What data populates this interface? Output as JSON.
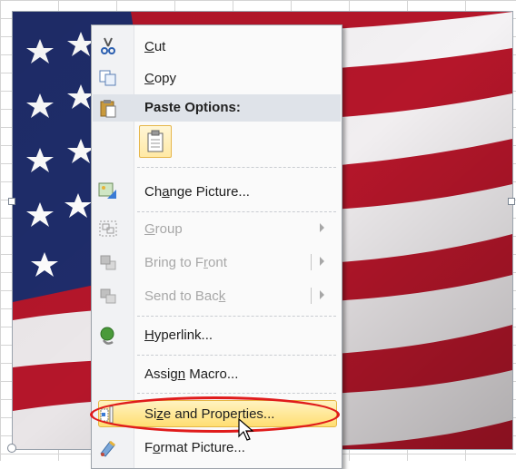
{
  "menu": {
    "items": [
      {
        "label_pre": "",
        "label_u": "C",
        "label_post": "ut",
        "icon": "scissors-icon",
        "enabled": true
      },
      {
        "label_pre": "",
        "label_u": "C",
        "label_post": "opy",
        "icon": "copy-icon",
        "enabled": true
      },
      {
        "label": "Paste Options:",
        "icon": "paste-icon",
        "enabled": true
      },
      {
        "label_pre": "Ch",
        "label_u": "a",
        "label_post": "nge Picture...",
        "icon": "change-picture-icon",
        "enabled": true
      },
      {
        "label_pre": "",
        "label_u": "G",
        "label_post": "roup",
        "icon": "group-icon",
        "enabled": false
      },
      {
        "label_pre": "Bring to F",
        "label_u": "r",
        "label_post": "ont",
        "icon": "bring-to-front-icon",
        "enabled": false
      },
      {
        "label_pre": "Send to Bac",
        "label_u": "k",
        "label_post": "",
        "icon": "send-to-back-icon",
        "enabled": false
      },
      {
        "label_pre": "",
        "label_u": "H",
        "label_post": "yperlink...",
        "icon": "hyperlink-icon",
        "enabled": true
      },
      {
        "label_pre": "Assig",
        "label_u": "n",
        "label_post": " Macro...",
        "icon": "",
        "enabled": true
      },
      {
        "label_pre": "Si",
        "label_u": "z",
        "label_post": "e and Properties...",
        "icon": "size-properties-icon",
        "enabled": true,
        "highlighted": true
      },
      {
        "label_pre": "F",
        "label_u": "o",
        "label_post": "rmat Picture...",
        "icon": "format-picture-icon",
        "enabled": true
      }
    ]
  },
  "colors": {
    "highlight": "#ffde72",
    "annotation_ring": "#e01b1b",
    "flag_red": "#b5162a",
    "flag_blue": "#1f2d6b"
  }
}
